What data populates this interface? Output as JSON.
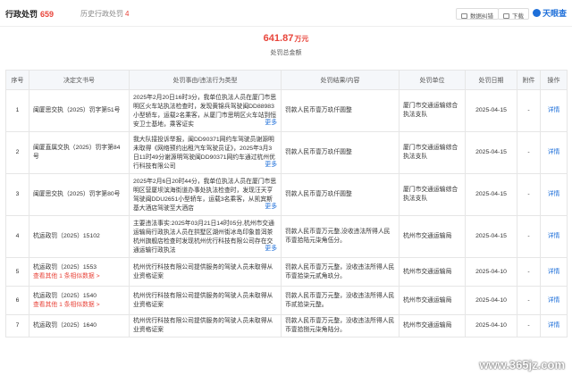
{
  "tabs": {
    "active_label": "行政处罚",
    "active_count": "659",
    "history_label": "历史行政处罚",
    "history_count": "4"
  },
  "toolbar": {
    "error_label": "数据纠错",
    "download_label": "下载",
    "brand": "天眼查"
  },
  "summary": {
    "amount": "641.87",
    "unit": "万元",
    "label": "处罚总金额"
  },
  "columns": [
    "序号",
    "决定文书号",
    "处罚事由/违法行为类型",
    "处罚结果/内容",
    "处罚单位",
    "处罚日期",
    "附件",
    "操作"
  ],
  "rows": [
    {
      "no": "1",
      "doc": "闽厦思交执（2025）罚字第51号",
      "reason": "2025年2月20日16时3分，我单位执法人员在厦门市思明区火车站执法检查时，发现黄锦兵驾驶闽DD88983小型轿车，运载2名乘客，从厦门市思明区火车站到恒安卫士基地，乘客证实",
      "more": "更多",
      "result": "罚款人民币壹万玖仟圆整",
      "authority": "厦门市交通运输综合执法支队",
      "date": "2025-04-15",
      "attach": "-",
      "op": "详情",
      "others": ""
    },
    {
      "no": "2",
      "doc": "闽厦直属交执（2025）罚字第84号",
      "reason": "我大队接投诉举报，闽DD90371网约车驾驶员谢源明未取得《网络预约出租汽车驾驶员证》，2025年3月3日11时49分谢源明驾驶闽DD90371网约车通过杭州优行科技有限公司",
      "more": "更多",
      "result": "罚款人民币壹万玖仟圆整",
      "authority": "厦门市交通运输综合执法支队",
      "date": "2025-04-15",
      "attach": "-",
      "op": "详情",
      "others": ""
    },
    {
      "no": "3",
      "doc": "闽厦思交执（2025）罚字第80号",
      "reason": "2025年2月6日20时44分，我单位执法人员在厦门市思明区营厦坝滨海街道办事处执法检查时，发现汪天亨驾驶闽DDU2651小型轿车，运载3名乘客，从凯宾斯基大酒店驾驶至大酒店",
      "more": "更多",
      "result": "罚款人民币壹万玖仟圆整",
      "authority": "厦门市交通运输综合执法支队",
      "date": "2025-04-15",
      "attach": "-",
      "op": "详情",
      "others": ""
    },
    {
      "no": "4",
      "doc": "杭运政罚（2025）15102",
      "reason": "主要违法事实:2025年03月21日14时05分,杭州市交通运输局行政执法人员在拱墅区湖州街冰岛印象普洱茶杭州旗舰店检查时发现杭州优行科技有限公司存在交通运输行政执法",
      "more": "更多",
      "result": "罚款人民币壹万元整,没收违法所得人民币壹拾陆元柒角伍分。",
      "authority": "杭州市交通运输局",
      "date": "2025-04-15",
      "attach": "-",
      "op": "详情",
      "others": ""
    },
    {
      "no": "5",
      "doc": "杭运政罚（2025）1553",
      "reason": "杭州优行科技有限公司提供服务的驾驶人员未取得从业资格证案",
      "more": "",
      "result": "罚款人民币壹万元整，没收违法所得人民币壹拾柒元贰角玖分。",
      "authority": "杭州市交通运输局",
      "date": "2025-04-10",
      "attach": "-",
      "op": "详情",
      "others": "查看其他 1 条相似数据 >"
    },
    {
      "no": "6",
      "doc": "杭运政罚（2025）1540",
      "reason": "杭州优行科技有限公司提供服务的驾驶人员未取得从业资格证案",
      "more": "",
      "result": "罚款人民币壹万元整，没收违法所得人民币贰拾柒元整。",
      "authority": "杭州市交通运输局",
      "date": "2025-04-10",
      "attach": "-",
      "op": "详情",
      "others": "查看其他 1 条相似数据 >"
    },
    {
      "no": "7",
      "doc": "杭运政罚（2025）1640",
      "reason": "杭州优行科技有限公司提供服务的驾驶人员未取得从业资格证案",
      "more": "",
      "result": "罚款人民币壹万元整，没收违法所得人民币壹拾捌元柒角陆分。",
      "authority": "杭州市交通运输局",
      "date": "2025-04-10",
      "attach": "-",
      "op": "详情",
      "others": ""
    }
  ],
  "watermark": "www.365jz.com"
}
